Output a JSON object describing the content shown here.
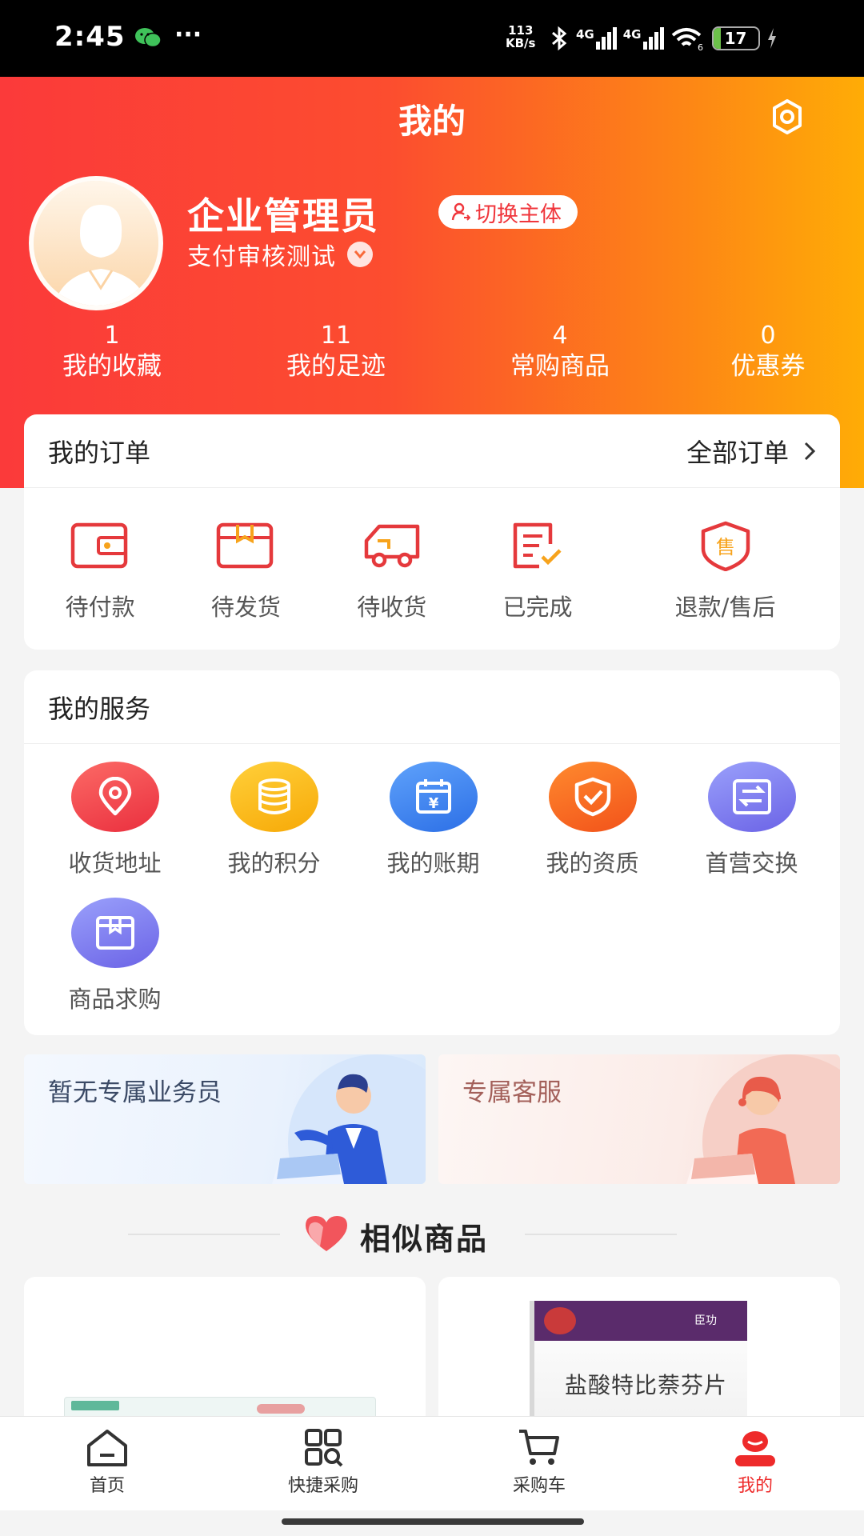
{
  "status_bar": {
    "time": "2:45",
    "speed_value": "113",
    "speed_unit": "KB/s",
    "net1": "4G",
    "net2": "4G",
    "battery": "17",
    "battery_level": 0.17
  },
  "header": {
    "title": "我的",
    "settings_icon": "gear-icon"
  },
  "profile": {
    "name": "企业管理员",
    "switch_label": "切换主体",
    "company": "支付审核测试"
  },
  "stats": [
    {
      "value": "1",
      "label": "我的收藏"
    },
    {
      "value": "11",
      "label": "我的足迹"
    },
    {
      "value": "4",
      "label": "常购商品"
    },
    {
      "value": "0",
      "label": "优惠券"
    }
  ],
  "orders": {
    "title": "我的订单",
    "all_label": "全部订单",
    "items": [
      {
        "label": "待付款",
        "icon": "wallet-icon"
      },
      {
        "label": "待发货",
        "icon": "package-icon"
      },
      {
        "label": "待收货",
        "icon": "truck-icon"
      },
      {
        "label": "已完成",
        "icon": "checklist-icon"
      },
      {
        "label": "退款/售后",
        "icon": "after-sales-icon",
        "icon_text": "售"
      }
    ]
  },
  "services": {
    "title": "我的服务",
    "items": [
      {
        "label": "收货地址",
        "icon": "location-pin-icon",
        "color": "#f0484c"
      },
      {
        "label": "我的积分",
        "icon": "coins-icon",
        "color": "#f7b80c"
      },
      {
        "label": "我的账期",
        "icon": "calendar-yen-icon",
        "color": "#3d82ee"
      },
      {
        "label": "我的资质",
        "icon": "shield-check-icon",
        "color": "#f86a1c"
      },
      {
        "label": "首营交换",
        "icon": "exchange-icon",
        "color": "#7d7ef0"
      },
      {
        "label": "商品求购",
        "icon": "box-icon",
        "color": "#7d7ef0"
      }
    ]
  },
  "banners": {
    "salesman": "暂无专属业务员",
    "service": "专属客服"
  },
  "similar": {
    "title": "相似商品"
  },
  "products": [
    {
      "name": "盐酸特比萘芬片",
      "brand": "臣功"
    }
  ],
  "tabbar": [
    {
      "label": "首页",
      "icon": "home-icon"
    },
    {
      "label": "快捷采购",
      "icon": "quick-purchase-icon"
    },
    {
      "label": "采购车",
      "icon": "cart-icon"
    },
    {
      "label": "我的",
      "icon": "profile-icon",
      "active": true
    }
  ],
  "colors": {
    "accent": "#ee2a2a",
    "header_start": "#fb3a3a",
    "header_end": "#ffac06"
  }
}
